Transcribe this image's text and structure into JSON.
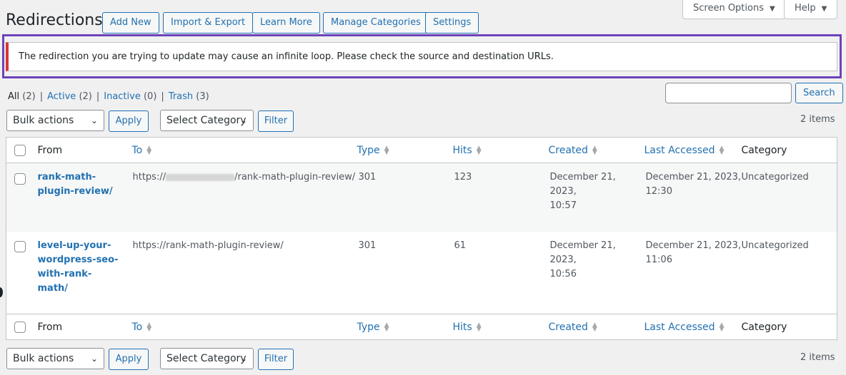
{
  "header": {
    "title": "Redirections",
    "actions": [
      "Add New",
      "Import & Export",
      "Learn More",
      "Manage Categories",
      "Settings"
    ],
    "screen_options": "Screen Options",
    "help": "Help"
  },
  "notice": {
    "text": "The redirection you are trying to update may cause an infinite loop. Please check the source and destination URLs."
  },
  "filters": {
    "all_label": "All",
    "all_count": "(2)",
    "active_label": "Active",
    "active_count": "(2)",
    "inactive_label": "Inactive",
    "inactive_count": "(0)",
    "trash_label": "Trash",
    "trash_count": "(3)"
  },
  "search": {
    "button": "Search",
    "value": ""
  },
  "tablenav": {
    "bulk_actions": "Bulk actions",
    "apply": "Apply",
    "select_category": "Select Category",
    "filter": "Filter",
    "items_count": "2 items"
  },
  "table": {
    "columns": {
      "from": "From",
      "to": "To",
      "type": "Type",
      "hits": "Hits",
      "created": "Created",
      "last_accessed": "Last Accessed",
      "category": "Category"
    },
    "rows": [
      {
        "from": "rank-math-plugin-review/",
        "to_prefix": "https://",
        "to_suffix": "/rank-math-plugin-review/",
        "type": "301",
        "hits": "123",
        "created_date": "December 21, 2023,",
        "created_time": "10:57",
        "last_date": "December 21, 2023,",
        "last_time": "12:30",
        "category": "Uncategorized"
      },
      {
        "from": "level-up-your-wordpress-seo-with-rank-math/",
        "to": "https://rank-math-plugin-review/",
        "type": "301",
        "hits": "61",
        "created_date": "December 21, 2023,",
        "created_time": "10:56",
        "last_date": "December 21, 2023,",
        "last_time": "11:06",
        "category": "Uncategorized"
      }
    ]
  },
  "colors": {
    "accent": "#2271b1",
    "notice_error": "#d63638",
    "highlight_frame": "#6d42b8",
    "background": "#f0f0f1"
  },
  "icons": [
    "chevron-down-icon",
    "sort-icon",
    "checkbox-icon"
  ]
}
